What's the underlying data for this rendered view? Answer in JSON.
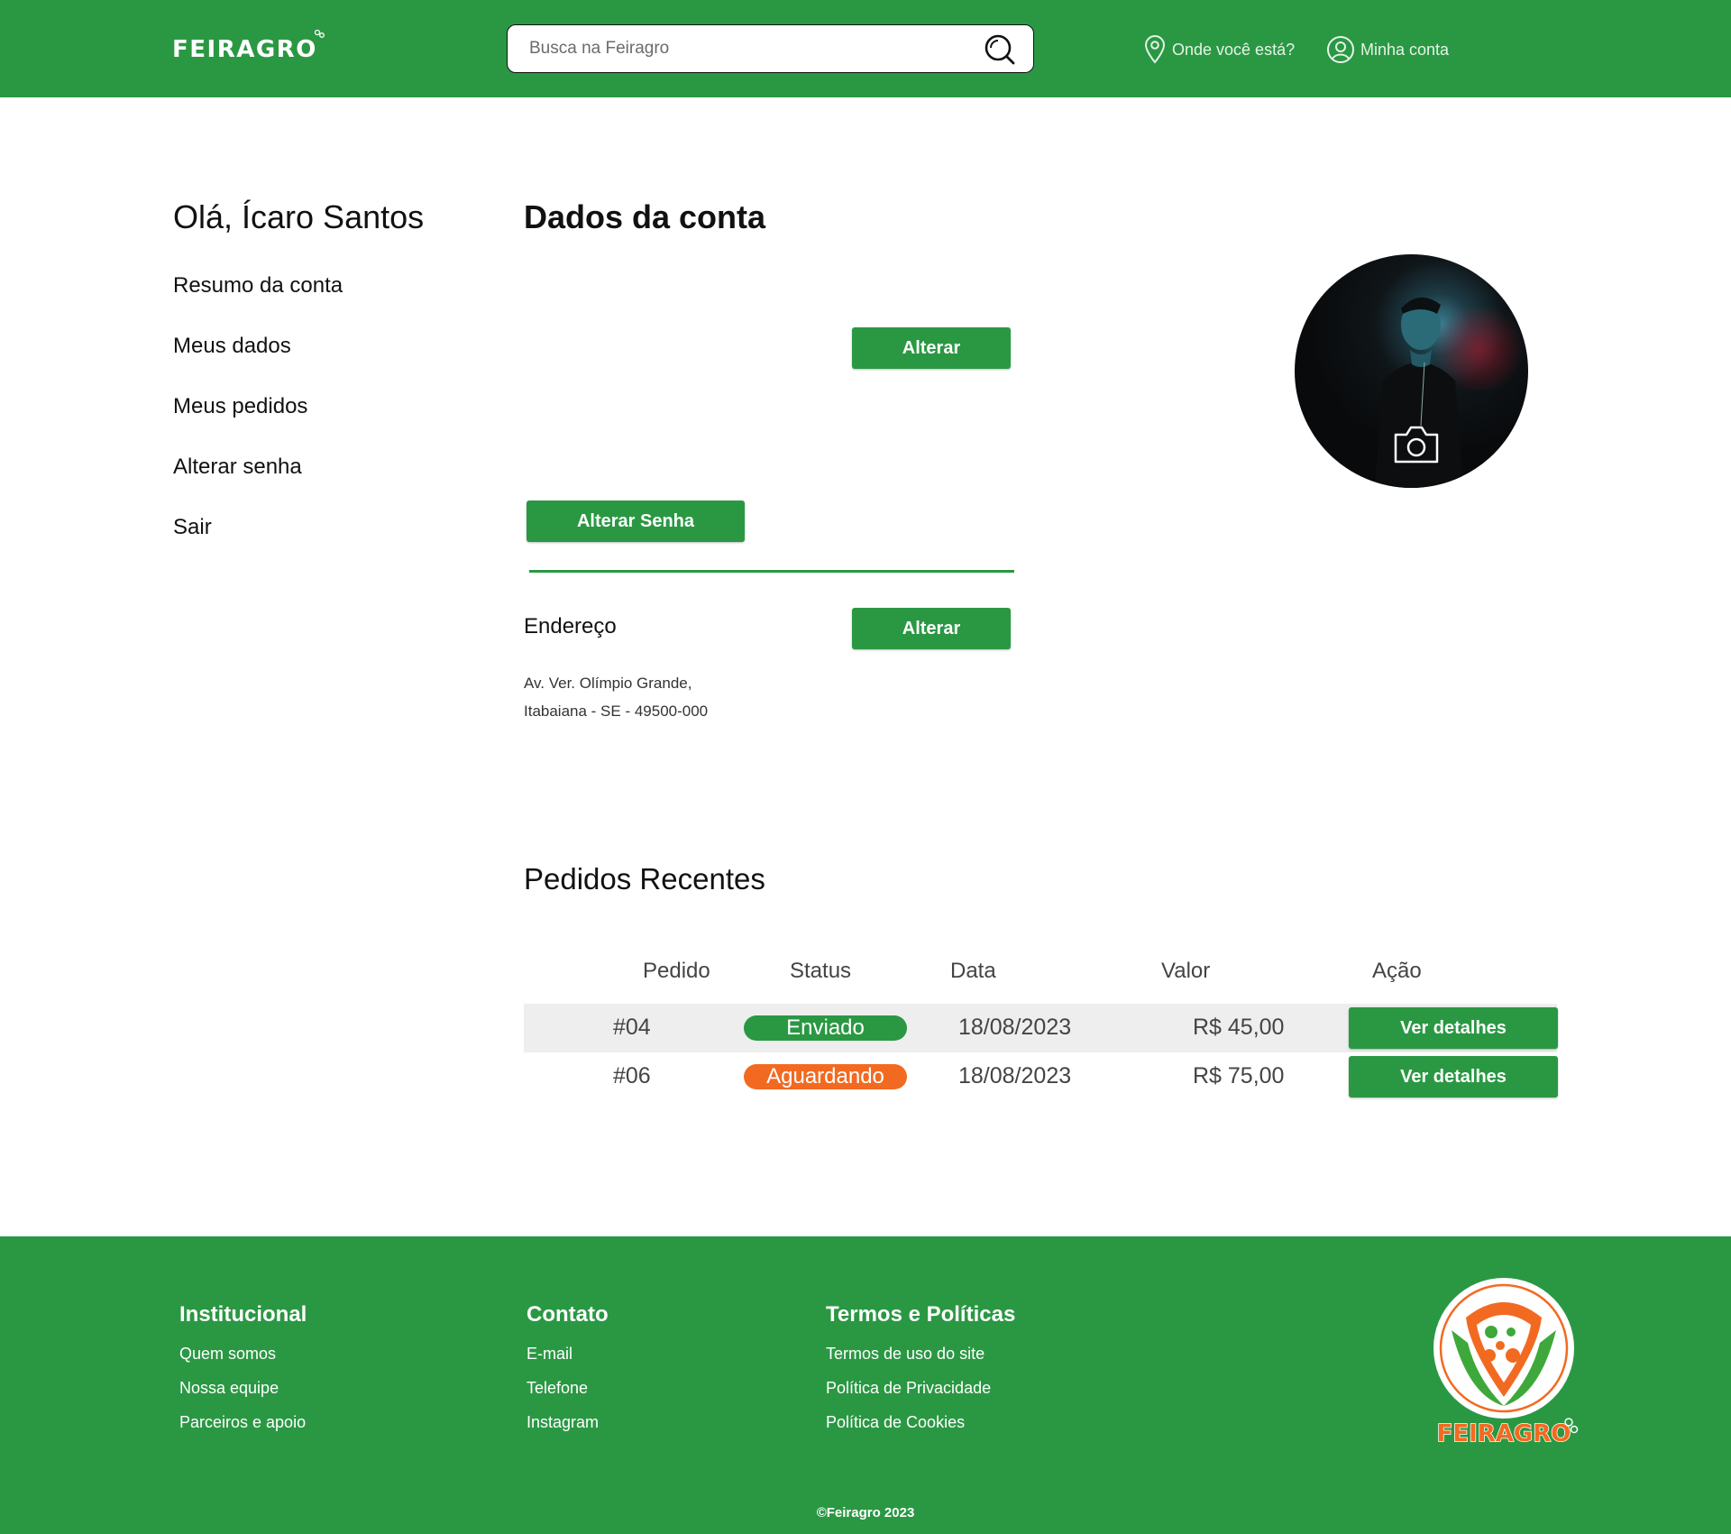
{
  "header": {
    "logo_text": "FEIRAGRO",
    "search_placeholder": "Busca na Feiragro",
    "location_label": "Onde você está?",
    "account_label": "Minha conta"
  },
  "sidebar": {
    "greeting": "Olá, Ícaro Santos",
    "items": [
      {
        "label": "Resumo da conta"
      },
      {
        "label": "Meus dados"
      },
      {
        "label": "Meus pedidos"
      },
      {
        "label": "Alterar senha"
      },
      {
        "label": "Sair"
      }
    ]
  },
  "account": {
    "title": "Dados da conta",
    "alter_button": "Alterar",
    "alter_password_button": "Alterar Senha",
    "address_label": "Endereço",
    "address_alter_button": "Alterar",
    "address_line1": "Av. Ver. Olímpio Grande,",
    "address_line2": "Itabaiana - SE - 49500-000"
  },
  "orders": {
    "title": "Pedidos Recentes",
    "headers": [
      "Pedido",
      "Status",
      "Data",
      "Valor",
      "Ação"
    ],
    "rows": [
      {
        "id": "#04",
        "status": "Enviado",
        "status_color": "#2a9843",
        "date": "18/08/2023",
        "value": "R$ 45,00",
        "action": "Ver detalhes"
      },
      {
        "id": "#06",
        "status": "Aguardando",
        "status_color": "#f26a21",
        "date": "18/08/2023",
        "value": "R$ 75,00",
        "action": "Ver detalhes"
      }
    ]
  },
  "footer": {
    "institucional": {
      "title": "Institucional",
      "links": [
        "Quem somos",
        "Nossa equipe",
        "Parceiros e apoio"
      ]
    },
    "contato": {
      "title": "Contato",
      "links": [
        "E-mail",
        "Telefone",
        "Instagram"
      ]
    },
    "termos": {
      "title": "Termos e Políticas",
      "links": [
        "Termos de uso do site",
        "Política de Privacidade",
        "Política de Cookies"
      ]
    },
    "logo_text": "FEIRAGRO",
    "copyright": "©Feiragro 2023"
  },
  "colors": {
    "brand_green": "#2a9843",
    "accent_orange": "#f26a21"
  },
  "icons": [
    "search-icon",
    "location-pin-icon",
    "user-icon",
    "camera-icon"
  ]
}
